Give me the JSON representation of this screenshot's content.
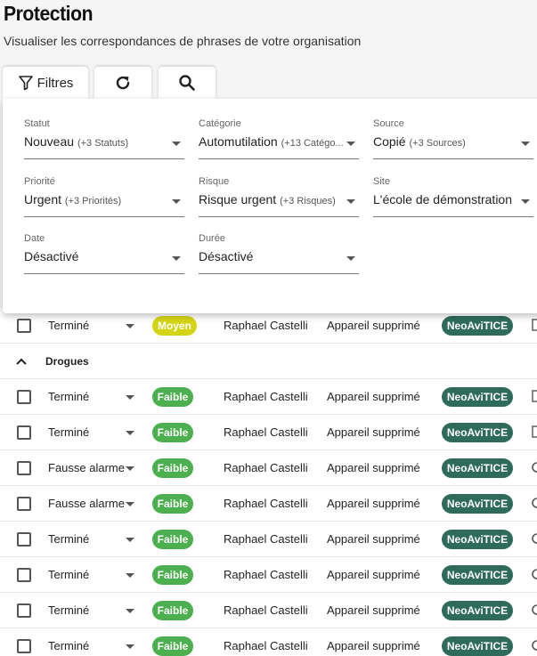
{
  "page": {
    "title": "Protection",
    "subtitle": "Visualiser les correspondances de phrases de votre organisation"
  },
  "toolbar": {
    "filters_label": "Filtres"
  },
  "filters": [
    {
      "label": "Statut",
      "value": "Nouveau",
      "extra": "(+3 Statuts)"
    },
    {
      "label": "Catégorie",
      "value": "Automutilation",
      "extra": "(+13 Catégo..."
    },
    {
      "label": "Source",
      "value": "Copié",
      "extra": "(+3 Sources)"
    },
    {
      "label": "Priorité",
      "value": "Urgent",
      "extra": "(+3 Priorités)"
    },
    {
      "label": "Risque",
      "value": "Risque urgent",
      "extra": "(+3 Risques)"
    },
    {
      "label": "Site",
      "value": "L'école de démonstration",
      "extra": ""
    },
    {
      "label": "Date",
      "value": "Désactivé",
      "extra": ""
    },
    {
      "label": "Durée",
      "value": "Désactivé",
      "extra": ""
    }
  ],
  "table": {
    "top_row": {
      "status": "Terminé",
      "level": "Moyen",
      "user": "Raphael Castelli",
      "device": "Appareil supprimé",
      "site": "NeoAviTICE"
    },
    "group": {
      "label": "Drogues"
    },
    "rows": [
      {
        "status": "Terminé",
        "level": "Faible",
        "user": "Raphael Castelli",
        "device": "Appareil supprimé",
        "site": "NeoAviTICE"
      },
      {
        "status": "Terminé",
        "level": "Faible",
        "user": "Raphael Castelli",
        "device": "Appareil supprimé",
        "site": "NeoAviTICE"
      },
      {
        "status": "Fausse alarme",
        "level": "Faible",
        "user": "Raphael Castelli",
        "device": "Appareil supprimé",
        "site": "NeoAviTICE"
      },
      {
        "status": "Fausse alarme",
        "level": "Faible",
        "user": "Raphael Castelli",
        "device": "Appareil supprimé",
        "site": "NeoAviTICE"
      },
      {
        "status": "Terminé",
        "level": "Faible",
        "user": "Raphael Castelli",
        "device": "Appareil supprimé",
        "site": "NeoAviTICE"
      },
      {
        "status": "Terminé",
        "level": "Faible",
        "user": "Raphael Castelli",
        "device": "Appareil supprimé",
        "site": "NeoAviTICE"
      },
      {
        "status": "Terminé",
        "level": "Faible",
        "user": "Raphael Castelli",
        "device": "Appareil supprimé",
        "site": "NeoAviTICE"
      },
      {
        "status": "Terminé",
        "level": "Faible",
        "user": "Raphael Castelli",
        "device": "Appareil supprimé",
        "site": "NeoAviTICE"
      }
    ]
  },
  "colors": {
    "faible": "#4caf50",
    "moyen": "#d4d414",
    "site_badge": "#2e6b5a"
  }
}
